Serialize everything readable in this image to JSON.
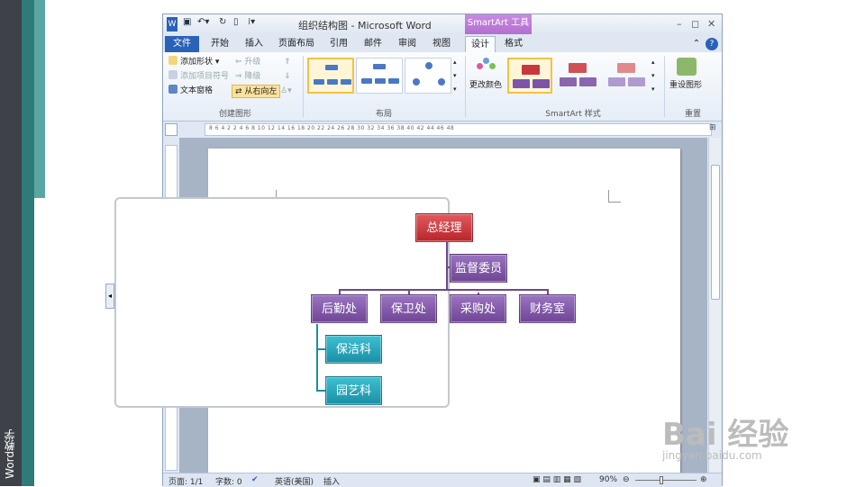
{
  "slide": {
    "side_label": "Word教学"
  },
  "window": {
    "title": "组织结构图 - Microsoft Word",
    "contextual_tab": "SmartArt 工具",
    "controls": {
      "minimize": "–",
      "restore": "◻",
      "close": "✕"
    }
  },
  "tabs": [
    "文件",
    "开始",
    "插入",
    "页面布局",
    "引用",
    "邮件",
    "审阅",
    "视图",
    "设计",
    "格式"
  ],
  "ribbon": {
    "create": {
      "label": "创建图形",
      "add_shape": "添加形状",
      "add_bullet": "添加项目符号",
      "text_pane": "文本窗格",
      "promote": "升级",
      "demote": "降级",
      "rtl": "从右向左"
    },
    "layout": {
      "label": "布局"
    },
    "styles": {
      "label": "SmartArt 样式",
      "change_colors": "更改颜色"
    },
    "reset": {
      "label": "重置",
      "reset_graphic": "重设图形"
    }
  },
  "ruler_text": "8  6  4  2   2  4  6  8  10  12  14  16  18  20  22  24  26  28  30  32  34  36  38  40  42  44  46  48",
  "orgchart": {
    "ceo": "总经理",
    "assistant": "监督委员会",
    "departments": [
      "后勤处",
      "保卫处",
      "采购处",
      "财务室"
    ],
    "sub_units": [
      "保洁科",
      "园艺科"
    ]
  },
  "status": {
    "page": "页面: 1/1",
    "words": "字数: 0",
    "language": "英语(美国)",
    "mode": "插入",
    "zoom": "90%"
  },
  "watermark": {
    "brand": "Bai 经验",
    "url": "jingyan.baidu.com"
  },
  "colors": {
    "ceo": "#c9363b",
    "dept": "#7d55a6",
    "sub": "#29a8bd",
    "accent": "#2a62b8"
  }
}
